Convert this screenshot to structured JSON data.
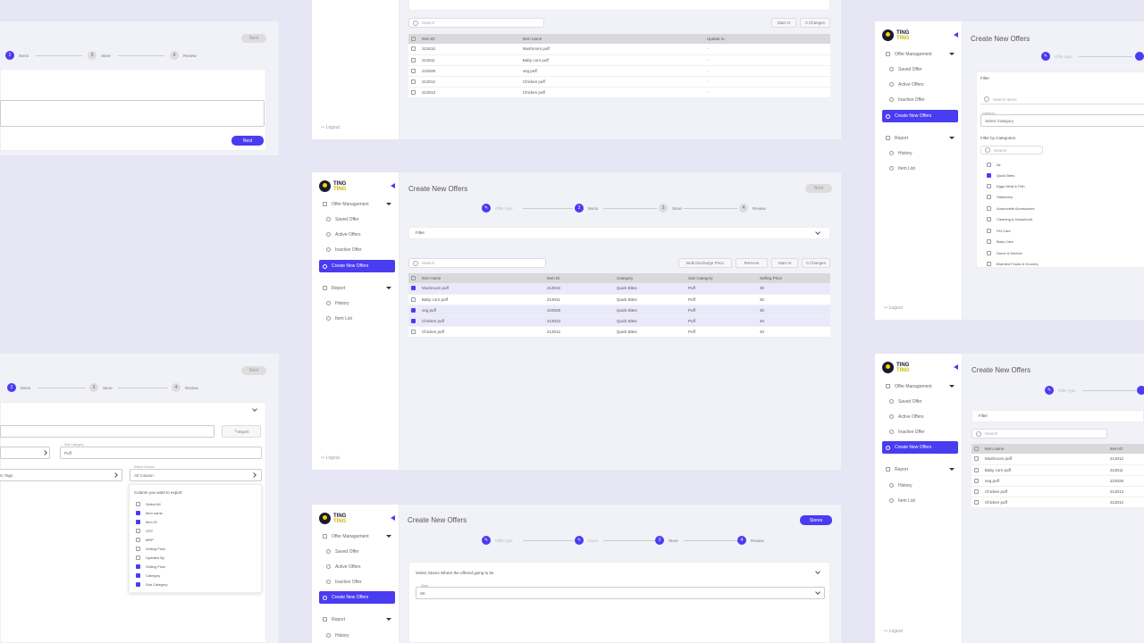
{
  "brand": {
    "line1": "TING",
    "line2": "TING"
  },
  "colors": {
    "accent": "#4a3cf0",
    "page_bg": "#e6e6f4"
  },
  "sidebar": {
    "offer_management": "Offer Management",
    "saved_offer": "Saved Offer",
    "active_offers": "Active Offers",
    "inactive_offer": "Inactive Offer",
    "create_new_offers": "Create New Offers",
    "report": "Report",
    "history": "History",
    "item_list": "Item List",
    "logout": "Logout"
  },
  "page_title": "Create New Offers",
  "steps": {
    "offer_type": "Offer type",
    "items": "Items",
    "store": "Store",
    "review": "Review",
    "n2": "2",
    "n3": "3",
    "n4": "4"
  },
  "buttons": {
    "next": "Next",
    "import": "Import",
    "stores": "Stores",
    "start_at": "Start At",
    "changes": "0 Changes",
    "bulk_price": "Bulk Discharge Price",
    "remove": "Remove"
  },
  "filter": {
    "label": "Filter",
    "search_placeholder": "Search",
    "search_items": "Search Items",
    "category_label": "Category",
    "category_placeholder": "Select Category",
    "filter_by_categories": "Filter by Categories",
    "search_small": "Search",
    "categories": [
      "All",
      "Quick Bites",
      "Eggs Meat & Fish",
      "Stationery",
      "Automobile Accessories",
      "Cleaning & Household",
      "Pet Care",
      "Baby Care",
      "Home & Kitchen",
      "Branded Foods & Grocery"
    ]
  },
  "table_top": {
    "headers": [
      "Item ID",
      "Item name",
      "Update to"
    ],
    "rows": [
      [
        "213010",
        "Mushroom puff",
        "-"
      ],
      [
        "213011",
        "Baby corn puff",
        "-"
      ],
      [
        "210028",
        "veg puff",
        "-"
      ],
      [
        "213012",
        "Chicken puff",
        "-"
      ],
      [
        "213013",
        "Chicken puff",
        "-"
      ]
    ]
  },
  "table_mid": {
    "headers": [
      "Item name",
      "Item ID",
      "Category",
      "Sub Category",
      "Selling Price"
    ],
    "rows": [
      {
        "sel": true,
        "cells": [
          "Mushroom puff",
          "213010",
          "Quick Bites",
          "Puff",
          "30"
        ]
      },
      {
        "sel": false,
        "cells": [
          "Baby corn puff",
          "213011",
          "Quick Bites",
          "Puff",
          "30"
        ]
      },
      {
        "sel": true,
        "cells": [
          "veg puff",
          "210028",
          "Quick Bites",
          "Puff",
          "30"
        ]
      },
      {
        "sel": true,
        "cells": [
          "Chicken puff",
          "213013",
          "Quick Bites",
          "Puff",
          "40"
        ]
      },
      {
        "sel": false,
        "cells": [
          "Chicken puff",
          "213012",
          "Quick Bites",
          "Puff",
          "40"
        ]
      }
    ]
  },
  "table_right": {
    "headers": [
      "Item name",
      "Item ID"
    ],
    "rows": [
      [
        "Mushroom puff",
        "213012"
      ],
      [
        "Baby corn puff",
        "213011"
      ],
      [
        "veg puff",
        "210028"
      ],
      [
        "Chicken puff",
        "213013"
      ],
      [
        "Chicken puff",
        "213012"
      ]
    ]
  },
  "export": {
    "sub_category_label": "Sub Category",
    "sub_category_value": "Puff",
    "item_tags": "Item Tags",
    "select_column_label": "Select Column",
    "select_column_value": "All Column",
    "title": "Column you want to export",
    "columns": [
      {
        "name": "Select All",
        "on": false
      },
      {
        "name": "Item name",
        "on": true
      },
      {
        "name": "Item ID",
        "on": true
      },
      {
        "name": "GST",
        "on": false
      },
      {
        "name": "MRP",
        "on": false
      },
      {
        "name": "Selling Price",
        "on": false
      },
      {
        "name": "Updated By",
        "on": false
      },
      {
        "name": "Selling Price",
        "on": true
      },
      {
        "name": "Category",
        "on": true
      },
      {
        "name": "Sub Category",
        "on": true
      }
    ]
  },
  "store": {
    "title": "Select Stores Where the offered going to be",
    "label": "Store",
    "value": "SK"
  }
}
